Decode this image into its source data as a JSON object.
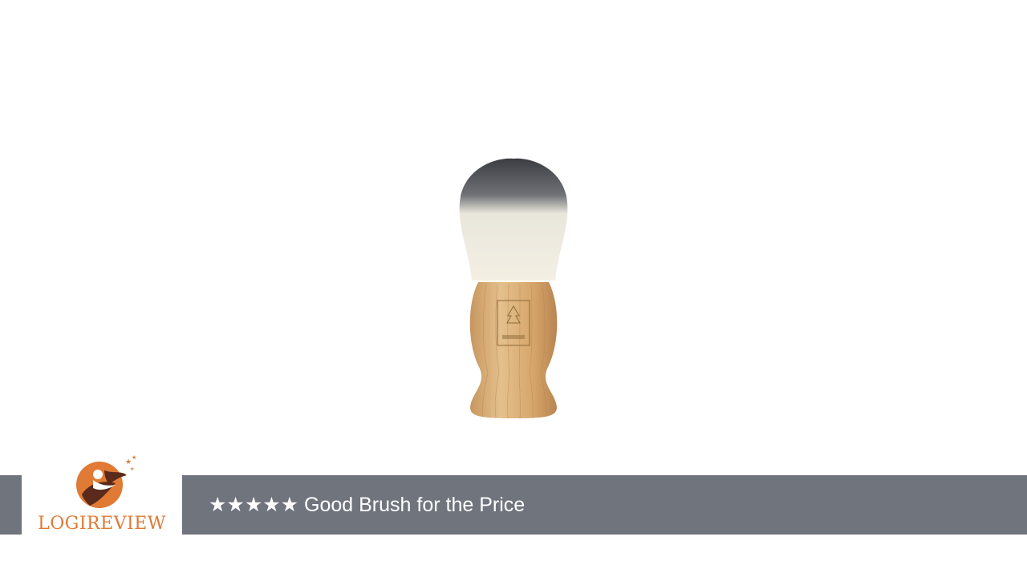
{
  "banner": {
    "logo_text": "LOGIREVIEW",
    "stars": "★★★★★",
    "title": "Good Brush for the Price"
  },
  "colors": {
    "band": "#6f747d",
    "logo_orange": "#e07a34",
    "logo_brown": "#5a2a1a"
  },
  "image": {
    "subject": "shaving-brush-icon"
  }
}
